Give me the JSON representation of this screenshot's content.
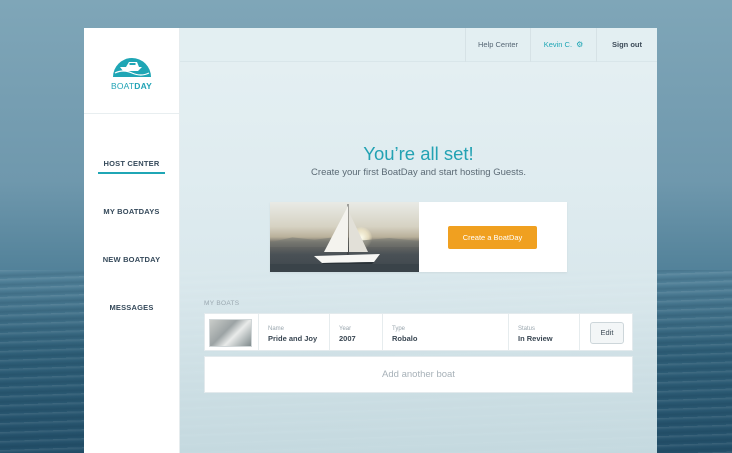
{
  "brand": {
    "logo_text_light": "BOAT",
    "logo_text_bold": "DAY",
    "primary_color": "#1fa6b5",
    "accent_color": "#f0a020"
  },
  "sidebar": {
    "items": [
      {
        "label": "HOST CENTER",
        "active": true
      },
      {
        "label": "MY BOATDAYS",
        "active": false
      },
      {
        "label": "NEW BOATDAY",
        "active": false
      },
      {
        "label": "MESSAGES",
        "active": false
      }
    ]
  },
  "topbar": {
    "help_label": "Help Center",
    "user_label": "Kevin C.",
    "user_icon": "gear-icon",
    "signout_label": "Sign out"
  },
  "main": {
    "headline": "You’re all set!",
    "subline": "Create your first BoatDay and start hosting Guests.",
    "create_button": "Create a BoatDay",
    "section_label": "MY BOATS",
    "boat": {
      "name_label": "Name",
      "name_value": "Pride and Joy",
      "year_label": "Year",
      "year_value": "2007",
      "type_label": "Type",
      "type_value": "Robalo",
      "status_label": "Status",
      "status_value": "In Review",
      "edit_label": "Edit"
    },
    "add_boat_label": "Add another boat"
  }
}
